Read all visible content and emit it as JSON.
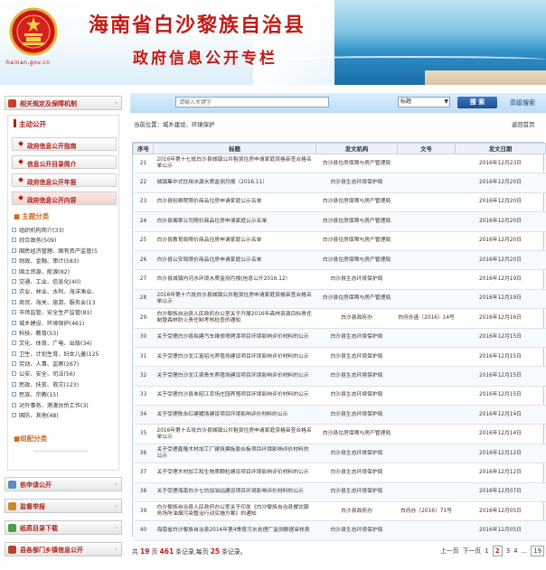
{
  "banner": {
    "county_title": "海南省白沙黎族自治县",
    "column_title": "政府信息公开专栏",
    "site_domain": "hainan.gov.cn"
  },
  "sidebar": {
    "sections": [
      {
        "label": "相关规定及保障机制"
      },
      {
        "label": "依申请公开"
      },
      {
        "label": "监督举报"
      },
      {
        "label": "纸质目录下载"
      },
      {
        "label": "县各部门乡镇信息公开"
      }
    ],
    "main_open": {
      "label": "主动公开",
      "buttons": [
        "政府信息公开指南",
        "信息公开目录简介",
        "政府信息公开年报",
        "政府信息公开内容"
      ]
    },
    "topics": {
      "label": "主题分类",
      "items": [
        "组织机构简介(33)",
        "综合政务(509)",
        "国民经济管理、国有资产监管(5",
        "财政、金融、审计(583)",
        "国土资源、能源(82)",
        "交通、工业、信息化(40)",
        "农业、林业、水利、海洋渔业、",
        "商贸、海关、旅游、服务业(13",
        "市场监管、安全生产监管(81)",
        "城乡建设、环境保护(461)",
        "科技、教育(53)",
        "文化、体育、广电、出版(34)",
        "卫生、计划生育、妇女儿童(125",
        "劳动、人事、监察(267)",
        "公安、安全、司法(56)",
        "民政、扶贫、救灾(123)",
        "民族、宗教(15)",
        "对外事务、港澳台侨工作(3)",
        "国防、其他(48)"
      ]
    },
    "group": {
      "label": "组配分类"
    }
  },
  "search": {
    "placeholder": "请输入关键字",
    "select_value": "标题",
    "button_label": "搜 索",
    "advanced_label": "高级搜索"
  },
  "breadcrumb": {
    "text": "当前位置：城乡建设、环境保护",
    "back_home": "返回首页"
  },
  "table": {
    "headers": [
      "序号",
      "标题",
      "发文机构",
      "文号",
      "发文日期"
    ],
    "rows": [
      {
        "no": "21",
        "title": "2016年第十七批白沙县城镇公共租赁住房申请家庭资格审查合格名单公示",
        "org": "白沙县住房保障与房产管理局",
        "doc": "",
        "date": "2016年12月23日"
      },
      {
        "no": "22",
        "title": "城镇集中式饮用水源水质监测月报（2016.11）",
        "org": "白沙县生态环境保护局",
        "doc": "",
        "date": "2016年12月20日"
      },
      {
        "no": "23",
        "title": "白沙县检察院限价商品住房申请家庭公示名单",
        "org": "白沙县住房保障与房产管理局",
        "doc": "",
        "date": "2016年12月20日"
      },
      {
        "no": "24",
        "title": "白沙县烟草公司限价商品住房申请家庭公示名单",
        "org": "白沙县住房保障与房产管理局",
        "doc": "",
        "date": "2016年12月20日"
      },
      {
        "no": "25",
        "title": "白沙县教育局限价商品住房申请家庭公示名单",
        "org": "白沙县住房保障与房产管理局",
        "doc": "",
        "date": "2016年12月20日"
      },
      {
        "no": "26",
        "title": "白沙县公安局限价商品住房申请家庭公示名单",
        "org": "白沙县住房保障与房产管理局",
        "doc": "",
        "date": "2016年12月20日"
      },
      {
        "no": "27",
        "title": "白沙县城镇内河水环境水质监测月报(信息公开2016.12）",
        "org": "白沙县生态环境保护局",
        "doc": "",
        "date": "2016年12月19日"
      },
      {
        "no": "28",
        "title": "2016年第十六批白沙县城镇公共租赁住房申请家庭资格审查合格名单公示",
        "org": "白沙县住房保障与房产管理局",
        "doc": "",
        "date": "2016年12月19日"
      },
      {
        "no": "29",
        "title": "白沙黎族自治县人民政府办公室关于开展2016年森林资源目标责任制暨森林防火责任制考核检查的通知",
        "org": "白沙县政府办",
        "doc": "白府办函〔2016〕14号",
        "date": "2016年12月16日"
      },
      {
        "no": "30",
        "title": "关于受理白沙县拟建汽车维修喷烤漆项目环境影响评价材料的公示",
        "org": "白沙县生态环境保护局",
        "doc": "",
        "date": "2016年12月15日"
      },
      {
        "no": "31",
        "title": "关于受理白沙龙江富绍光养殖场建设项目环境影响评价材料的公示",
        "org": "白沙县生态环境保护局",
        "doc": "",
        "date": "2016年12月15日"
      },
      {
        "no": "32",
        "title": "关于受理白沙龙江梁贵东养殖场建设项目环境影响评价材料的公示",
        "org": "白沙县生态环境保护局",
        "doc": "",
        "date": "2016年12月15日"
      },
      {
        "no": "33",
        "title": "关于受理白沙县朱昭江农场庄园养殖项目环境影响评价材料的公示",
        "org": "白沙县生态环境保护局",
        "doc": "",
        "date": "2016年12月15日"
      },
      {
        "no": "34",
        "title": "关于受理陈永红建猪场建设项目环境影响评价材料的公示",
        "org": "白沙县生态环境保护局",
        "doc": "",
        "date": "2016年12月14日"
      },
      {
        "no": "35",
        "title": "2016年第十五批白沙县城镇公共租赁住房申请家庭资格审查合格名单公示",
        "org": "白沙县住房保障与房产管理局",
        "doc": "",
        "date": "2016年12月14日"
      },
      {
        "no": "36",
        "title": "关于受理鑫隆木材加工厂建筑模板胶合板项目环境影响评价材料的公示",
        "org": "白沙县生态环境保护局",
        "doc": "",
        "date": "2016年12月12日"
      },
      {
        "no": "37",
        "title": "关于受理木材加工和生物质颗粒建设项目环境影响评价材料的公示",
        "org": "白沙县生态环境保护局",
        "doc": "",
        "date": "2016年12月12日"
      },
      {
        "no": "38",
        "title": "关于受理海南白沙七坊加油站建设项目环境影响评价材料的公示",
        "org": "白沙县生态环境保护局",
        "doc": "",
        "date": "2016年12月07日"
      },
      {
        "no": "39",
        "title": "白沙黎族自治县人民政府办公室关于印发《白沙黎族自治县餐饮服务场所油烟污染整治行动实施方案》的通知",
        "org": "白沙县政府办",
        "doc": "白府办〔2016〕71号",
        "date": "2016年12月05日"
      },
      {
        "no": "40",
        "title": "海南省白沙黎族自治县2016年第4季度污水处理厂监测数据审核表",
        "org": "白沙县生态环境保护局",
        "doc": "",
        "date": "2016年12月05日"
      }
    ]
  },
  "pagination": {
    "prefix": "共",
    "total_pages": "19",
    "mid1": "页",
    "total_records": "461",
    "mid2": "条记录,每页",
    "per_page": "25",
    "suffix": "条记录。",
    "prev": "上一页",
    "next": "下一页",
    "pages": [
      "1",
      "2",
      "3",
      "4"
    ],
    "current": "2",
    "ellipsis": "...",
    "last": "19"
  },
  "colors": {
    "brand_red": "#c21a14",
    "nav_blue": "#1b4e93",
    "topic_orange": "#d2691e"
  }
}
